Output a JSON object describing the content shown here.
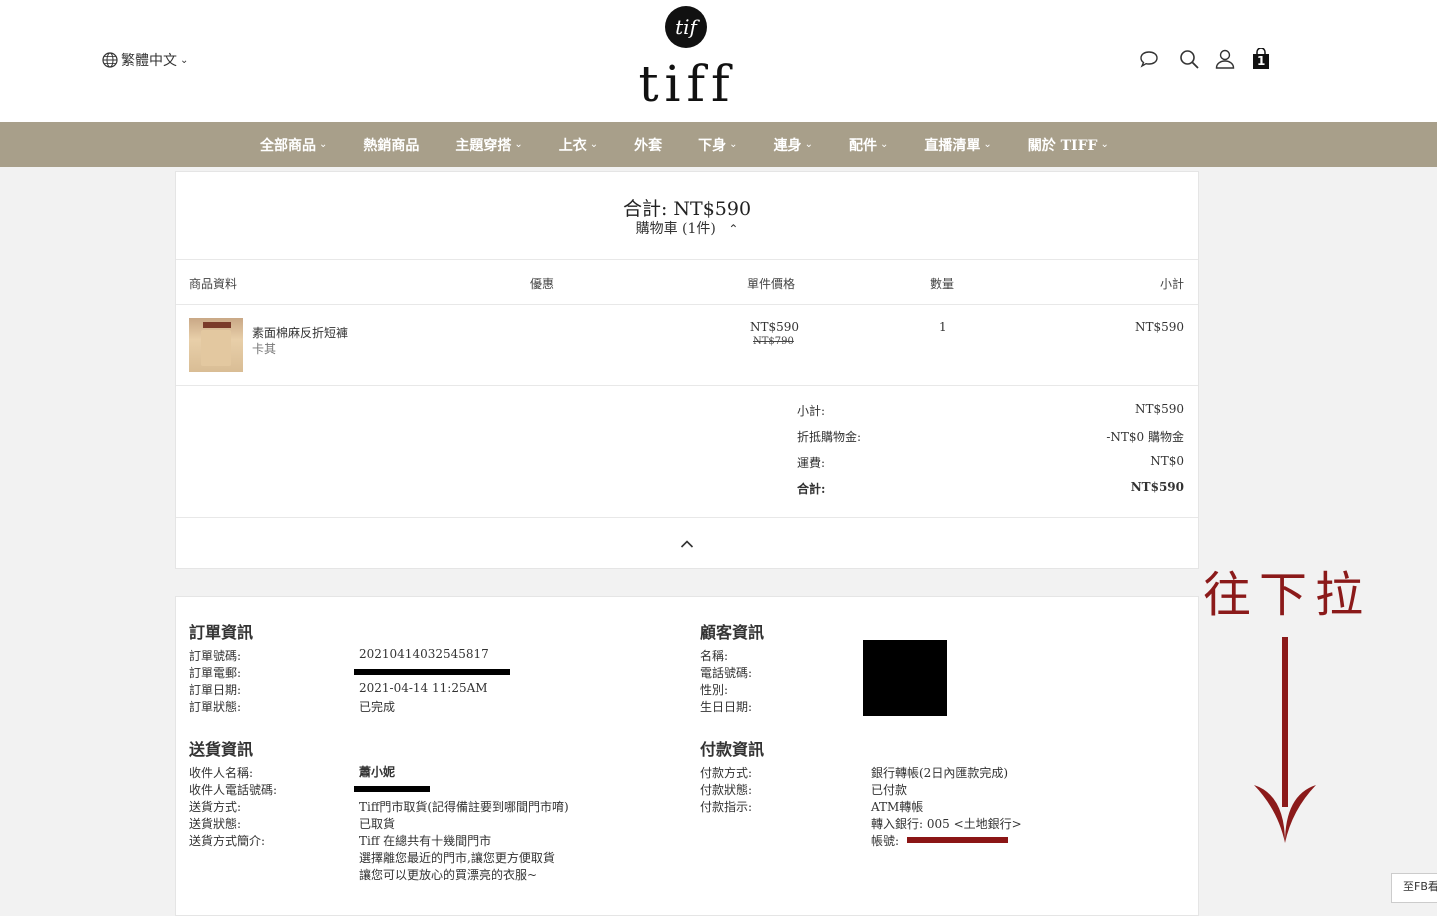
{
  "header": {
    "language": "繁體中文",
    "logo_text": "tiff",
    "logo_monogram": "tif",
    "cart_count": "1",
    "icons": [
      "chat-icon",
      "search-icon",
      "user-icon",
      "bag-icon"
    ]
  },
  "nav": {
    "items": [
      {
        "label": "全部商品",
        "dropdown": true
      },
      {
        "label": "熱銷商品",
        "dropdown": false
      },
      {
        "label": "主題穿搭",
        "dropdown": true
      },
      {
        "label": "上衣",
        "dropdown": true
      },
      {
        "label": "外套",
        "dropdown": false
      },
      {
        "label": "下身",
        "dropdown": true
      },
      {
        "label": "連身",
        "dropdown": true
      },
      {
        "label": "配件",
        "dropdown": true
      },
      {
        "label": "直播清單",
        "dropdown": true
      },
      {
        "label": "關於 TIFF",
        "dropdown": true
      }
    ]
  },
  "cart": {
    "total_title": "合計: NT$590",
    "toggle_label": "購物車 (1件)",
    "columns": {
      "product": "商品資料",
      "discount": "優惠",
      "unit_price": "單件價格",
      "quantity": "數量",
      "subtotal": "小計"
    },
    "items": [
      {
        "name": "素面棉麻反折短褲",
        "variant": "卡其",
        "price": "NT$590",
        "original_price": "NT$790",
        "quantity": "1",
        "subtotal": "NT$590"
      }
    ],
    "summary": {
      "subtotal_label": "小計:",
      "subtotal_value": "NT$590",
      "credit_label": "折抵購物金:",
      "credit_value": "-NT$0 購物金",
      "shipping_label": "運費:",
      "shipping_value": "NT$0",
      "total_label": "合計:",
      "total_value": "NT$590"
    }
  },
  "order_info": {
    "title": "訂單資訊",
    "number_label": "訂單號碼:",
    "number_value": "20210414032545817",
    "email_label": "訂單電郵:",
    "date_label": "訂單日期:",
    "date_value": "2021-04-14 11:25AM",
    "status_label": "訂單狀態:",
    "status_value": "已完成"
  },
  "customer_info": {
    "title": "顧客資訊",
    "name_label": "名稱:",
    "phone_label": "電話號碼:",
    "gender_label": "性別:",
    "birthday_label": "生日日期:"
  },
  "delivery_info": {
    "title": "送貨資訊",
    "recipient_label": "收件人名稱:",
    "recipient_value": "蕭小妮",
    "phone_label": "收件人電話號碼:",
    "method_label": "送貨方式:",
    "method_value": "Tiff門市取貨(記得備註要到哪間門市唷)",
    "status_label": "送貨狀態:",
    "status_value": "已取貨",
    "intro_label": "送貨方式簡介:",
    "intro_lines": [
      "Tiff 在總共有十幾間門市",
      "選擇離您最近的門市,讓您更方便取貨",
      "讓您可以更放心的買漂亮的衣服~"
    ]
  },
  "payment_info": {
    "title": "付款資訊",
    "method_label": "付款方式:",
    "method_value": "銀行轉帳(2日內匯款完成)",
    "status_label": "付款狀態:",
    "status_value": "已付款",
    "instruction_label": "付款指示:",
    "instruction_lines": [
      "ATM轉帳",
      "轉入銀行:  005 <土地銀行>"
    ],
    "account_label": "帳號:"
  },
  "annotation": {
    "text": "往下拉",
    "color": "#8b1a1a"
  },
  "fb_tab": "至FB看"
}
